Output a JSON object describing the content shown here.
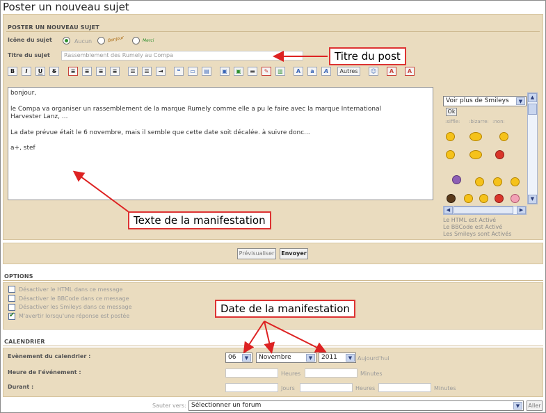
{
  "page_title": "Poster un nouveau sujet",
  "post_section": {
    "heading": "POSTER UN NOUVEAU SUJET",
    "icon_label": "Icône du sujet",
    "icon_options": [
      "Aucun",
      "Bonjour",
      "Merci"
    ],
    "subject_label": "Titre du sujet",
    "subject_value": "Rassemblement des Rumely au Compa",
    "toolbar_autres": "Autres",
    "message_lines": [
      "bonjour,",
      "",
      "le Compa va organiser un rassemblement de la marque Rumely comme elle a pu le faire avec la marque International",
      "Harvester Lanz, ...",
      "",
      "La date prévue était le 6 novembre, mais il semble que cette date soit décalée. à suivre donc...",
      "",
      "a+, stef"
    ]
  },
  "smileys": {
    "select_label": "Voir plus de Smileys",
    "ok_label": "Ok",
    "codes": [
      ":siffle:",
      ":bizarre:",
      ":non:"
    ],
    "status": [
      "Le HTML est Activé",
      "Le BBCode est Activé",
      "Les Smileys sont Activés"
    ]
  },
  "buttons": {
    "preview": "Prévisualiser",
    "send": "Envoyer"
  },
  "options": {
    "heading": "OPTIONS",
    "items": [
      {
        "label": "Désactiver le HTML dans ce message",
        "checked": false
      },
      {
        "label": "Désactiver le BBCode dans ce message",
        "checked": false
      },
      {
        "label": "Désactiver les Smileys dans ce message",
        "checked": false
      },
      {
        "label": "M'avertir lorsqu'une réponse est postée",
        "checked": true
      }
    ]
  },
  "calendar": {
    "heading": "CALENDRIER",
    "event_label": "Evènement du calendrier :",
    "day": "06",
    "month": "Novembre",
    "year": "2011",
    "today_label": "Aujourd'hui",
    "time_label": "Heure de l'événement :",
    "duration_label": "Durant :",
    "unit_hours": "Heures",
    "unit_minutes": "Minutes",
    "unit_days": "Jours"
  },
  "jump": {
    "label": "Sauter vers:",
    "select_value": "Sélectionner un forum",
    "go": "Aller"
  },
  "annotations": {
    "title": "Titre du post",
    "text": "Texte de la manifestation",
    "date": "Date de la manifestation"
  },
  "colors": {
    "panel": "#eadcbf",
    "callout_border": "#dd3333",
    "accent_blue": "#c9d6ef"
  }
}
